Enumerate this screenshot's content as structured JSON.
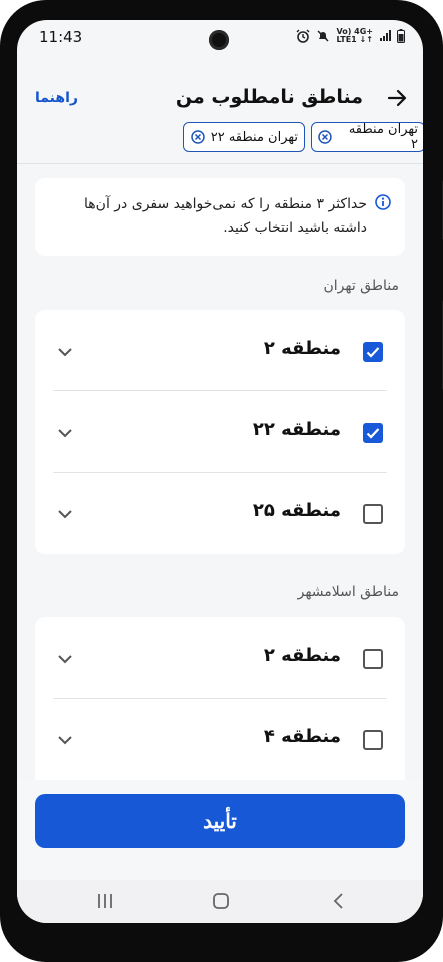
{
  "status": {
    "time": "11:43",
    "network_top": "Vo) 4G+",
    "network_bottom": "LTE1 ↓↑"
  },
  "header": {
    "title": "مناطق نامطلوب من",
    "help": "راهنما"
  },
  "chips": [
    {
      "label": "تهران منطقه ۲"
    },
    {
      "label": "تهران منطقه ۲۲"
    }
  ],
  "info": {
    "text": "حداکثر ۳ منطقه را که نمی‌خواهید سفری در آن‌ها داشته باشید انتخاب کنید."
  },
  "sections": [
    {
      "title": "مناطق تهران",
      "items": [
        {
          "label": "منطقه ۲",
          "checked": true
        },
        {
          "label": "منطقه ۲۲",
          "checked": true
        },
        {
          "label": "منطقه ۲۵",
          "checked": false
        }
      ]
    },
    {
      "title": "مناطق اسلامشهر",
      "items": [
        {
          "label": "منطقه ۲",
          "checked": false
        },
        {
          "label": "منطقه ۴",
          "checked": false
        }
      ]
    }
  ],
  "confirm": {
    "label": "تأیید"
  },
  "colors": {
    "accent": "#1758d6",
    "chip_border": "#1f55b8",
    "link": "#1454cc"
  }
}
